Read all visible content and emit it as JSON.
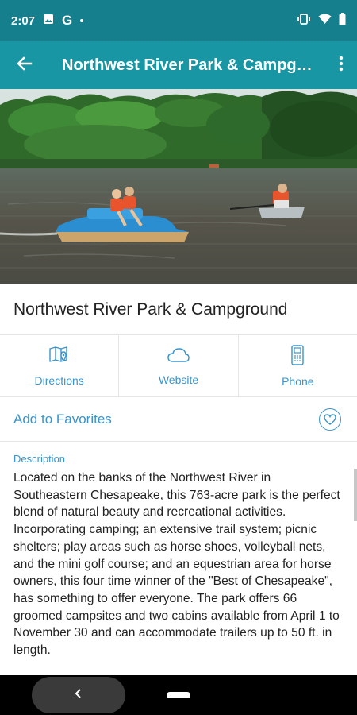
{
  "status_bar": {
    "time": "2:07",
    "g_letter": "G",
    "icons": [
      "image-icon",
      "google-icon",
      "notification-dot",
      "vibrate-icon",
      "wifi-icon",
      "battery-icon"
    ]
  },
  "app_bar": {
    "title": "Northwest River Park & Campground",
    "icons": [
      "back-arrow-icon",
      "more-vert-icon"
    ]
  },
  "hero_image": {
    "subject": "pedal boat and rowboat on a river with tree line"
  },
  "place": {
    "title": "Northwest River Park & Campground"
  },
  "actions": [
    {
      "label": "Directions",
      "icon": "map-icon"
    },
    {
      "label": "Website",
      "icon": "cloud-icon"
    },
    {
      "label": "Phone",
      "icon": "phone-icon"
    }
  ],
  "favorites": {
    "label": "Add to Favorites",
    "icon": "heart-icon"
  },
  "description": {
    "label": "Description",
    "text": "Located on the banks of the Northwest River in Southeastern Chesapeake, this 763-acre park is the perfect blend of natural beauty and recreational activities. Incorporating camping; an extensive trail system; picnic shelters; play areas such as horse shoes, volleyball nets, and the mini golf course; and an equestrian area for horse owners, this four time winner of the \"Best of Chesapeake\", has something to offer everyone. The park offers 66 groomed campsites and two cabins available from April 1 to November 30 and can accommodate trailers up to 50 ft. in length."
  },
  "colors": {
    "status_bar": "#167f8d",
    "app_bar": "#1896a3",
    "accent": "#3b94c9"
  }
}
